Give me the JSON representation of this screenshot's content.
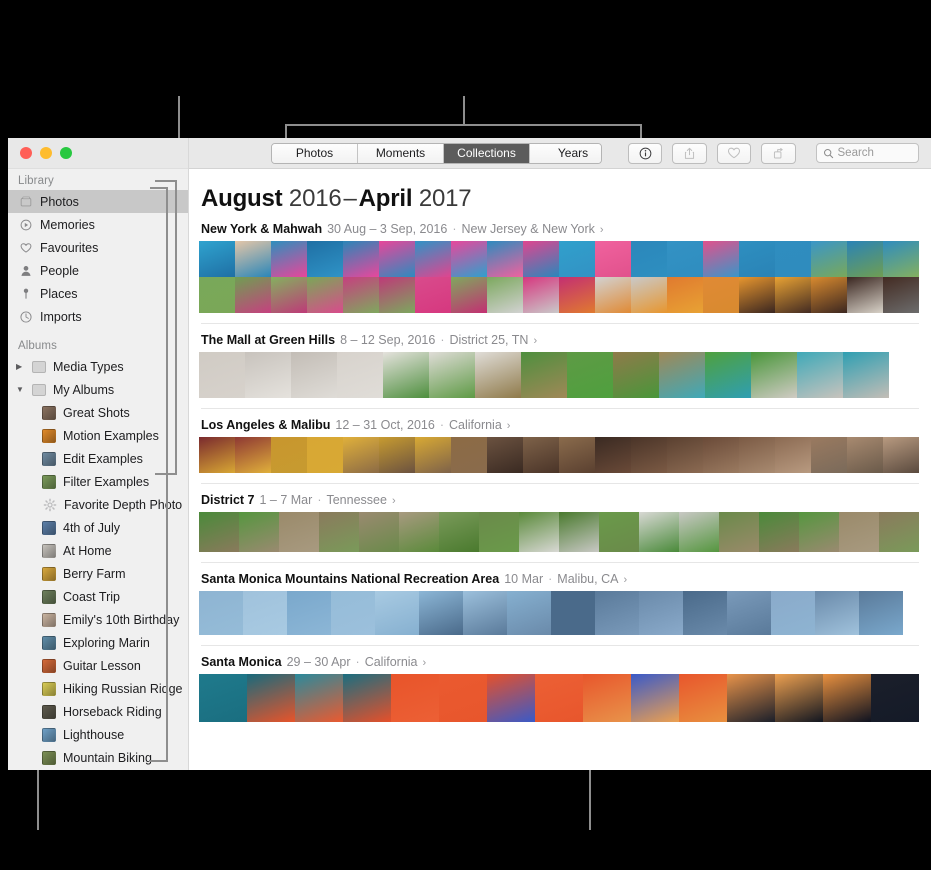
{
  "window": {
    "traffic_lights": [
      "close",
      "minimize",
      "zoom"
    ]
  },
  "sidebar": {
    "sections": [
      {
        "title": "Library",
        "items": [
          {
            "label": "Photos",
            "icon": "photos-icon",
            "selected": true
          },
          {
            "label": "Memories",
            "icon": "memories-icon",
            "selected": false
          },
          {
            "label": "Favourites",
            "icon": "heart-icon",
            "selected": false
          },
          {
            "label": "People",
            "icon": "person-icon",
            "selected": false
          },
          {
            "label": "Places",
            "icon": "pin-icon",
            "selected": false
          },
          {
            "label": "Imports",
            "icon": "clock-icon",
            "selected": false
          }
        ]
      },
      {
        "title": "Albums",
        "items": [
          {
            "label": "Media Types",
            "icon": "folder-icon",
            "disclosure": "collapsed",
            "indent": 0
          },
          {
            "label": "My Albums",
            "icon": "folder-icon",
            "disclosure": "expanded",
            "indent": 0
          },
          {
            "label": "Great Shots",
            "icon": "album-thumb",
            "indent": 1,
            "thumb": "#8a7260"
          },
          {
            "label": "Motion Examples",
            "icon": "album-thumb",
            "indent": 1,
            "thumb": "#e08a2a"
          },
          {
            "label": "Edit Examples",
            "icon": "album-thumb",
            "indent": 1,
            "thumb": "#6f8aa0"
          },
          {
            "label": "Filter Examples",
            "icon": "album-thumb",
            "indent": 1,
            "thumb": "#7a9a5a"
          },
          {
            "label": "Favorite Depth Photo",
            "icon": "gear-icon",
            "indent": 1
          },
          {
            "label": "4th of July",
            "icon": "album-thumb",
            "indent": 1,
            "thumb": "#5c7fa8"
          },
          {
            "label": "At Home",
            "icon": "album-thumb",
            "indent": 1,
            "thumb": "#c6c2bc"
          },
          {
            "label": "Berry Farm",
            "icon": "album-thumb",
            "indent": 1,
            "thumb": "#d8a83e"
          },
          {
            "label": "Coast Trip",
            "icon": "album-thumb",
            "indent": 1,
            "thumb": "#6d7f5c"
          },
          {
            "label": "Emily's 10th Birthday",
            "icon": "album-thumb",
            "indent": 1,
            "thumb": "#c9b3a0"
          },
          {
            "label": "Exploring Marin",
            "icon": "album-thumb",
            "indent": 1,
            "thumb": "#5f8ca8"
          },
          {
            "label": "Guitar Lesson",
            "icon": "album-thumb",
            "indent": 1,
            "thumb": "#d46a3a"
          },
          {
            "label": "Hiking Russian Ridge",
            "icon": "album-thumb",
            "indent": 1,
            "thumb": "#d8cb55"
          },
          {
            "label": "Horseback Riding",
            "icon": "album-thumb",
            "indent": 1,
            "thumb": "#5d5a4d"
          },
          {
            "label": "Lighthouse",
            "icon": "album-thumb",
            "indent": 1,
            "thumb": "#6fa0c6"
          },
          {
            "label": "Mountain Biking",
            "icon": "album-thumb",
            "indent": 1,
            "thumb": "#7b8f54"
          }
        ]
      }
    ]
  },
  "toolbar": {
    "segments": [
      {
        "label": "Photos",
        "active": false
      },
      {
        "label": "Moments",
        "active": false
      },
      {
        "label": "Collections",
        "active": true
      },
      {
        "label": "Years",
        "active": false
      }
    ],
    "buttons": [
      {
        "name": "info-button",
        "icon": "info-icon",
        "enabled": true
      },
      {
        "name": "share-button",
        "icon": "share-icon",
        "enabled": false
      },
      {
        "name": "favorite-button",
        "icon": "heart-icon",
        "enabled": false
      },
      {
        "name": "rotate-button",
        "icon": "rotate-icon",
        "enabled": false
      }
    ],
    "search": {
      "placeholder": "Search",
      "value": "",
      "icon": "search-icon"
    }
  },
  "main": {
    "title": {
      "month_start": "August",
      "year_start": "2016",
      "dash": "–",
      "month_end": "April",
      "year_end": "2017"
    },
    "collections": [
      {
        "name": "New York & Mahwah",
        "date": "30 Aug – 3 Sep, 2016",
        "separator": "·",
        "place": "New Jersey & New York",
        "chevron": "›",
        "rows": 2,
        "tile": 36,
        "tiles": [
          "#2fa3cf",
          "#e4c6a8",
          "#2d8fbd",
          "#1f6fa4",
          "#2a86b8",
          "#e8469a",
          "#2f93c6",
          "#e8479c",
          "#2d8bbe",
          "#e0458f",
          "#30a0cc",
          "#f0629e",
          "#2b87bb",
          "#3392c4",
          "#e1518c",
          "#2e8fc0",
          "#2f8dbf",
          "#3a96c8",
          "#2a83b6",
          "#2f8cbe",
          "#79a85a",
          "#6f9e52",
          "#84b05f",
          "#7aa757",
          "#c6407f",
          "#be3a78",
          "#d94b8c",
          "#7fa85e",
          "#7ca85e",
          "#d6387f",
          "#c32f72",
          "#d2d2d2",
          "#c9c9c9",
          "#e07a2f",
          "#e08a35",
          "#e7962f",
          "#e8a234",
          "#d88a2f",
          "#3a2620",
          "#432b22",
          "#3c2720",
          "#d8d2c8",
          "#6c6c6c",
          "#77777a",
          "#d6b58a",
          "#c8a179",
          "#8d8d90",
          "#8e8e92",
          "#8e8e92",
          "#5a5a5e",
          "#c99a6e",
          "#b88a5f",
          "#d9c23a",
          "#c8b133",
          "#9c6640"
        ]
      },
      {
        "name": "The Mall at Green Hills",
        "date": "8 – 12 Sep, 2016",
        "separator": "·",
        "place": "District 25, TN",
        "chevron": "›",
        "rows": 1,
        "tile": 46,
        "tiles": [
          "#d0cbc4",
          "#c8c3bd",
          "#c3bdb6",
          "#d7d2cc",
          "#e5e2dd",
          "#dfdcd7",
          "#e0ddd8",
          "#4e8f3e",
          "#5e9a45",
          "#8f7a4a",
          "#a08857",
          "#4fa03e",
          "#49963a",
          "#3fa9b8",
          "#2f9fb2"
        ]
      },
      {
        "name": "Los Angeles & Malibu",
        "date": "12 – 31 Oct, 2016",
        "separator": "·",
        "place": "California",
        "chevron": "›",
        "rows": 1,
        "tile": 36,
        "tiles": [
          "#7a2a2e",
          "#8e3833",
          "#c8962e",
          "#d8a734",
          "#e0b03b",
          "#c79b30",
          "#d8a934",
          "#8c6b45",
          "#6b5240",
          "#7e6249",
          "#8a6b4c",
          "#3a2a22",
          "#4a3428",
          "#5a4030",
          "#6a4a38",
          "#7b5a44",
          "#8b6a52",
          "#9a7a60",
          "#a88a70",
          "#b89a80",
          "#7a6a5a",
          "#6a5a4a",
          "#5a4a3e",
          "#8a7a6a",
          "#c8a878",
          "#d8b888",
          "#b89868",
          "#a88858"
        ]
      },
      {
        "name": "District 7",
        "date": "1 – 7 Mar",
        "separator": "·",
        "place": "Tennessee",
        "chevron": "›",
        "rows": 1,
        "tile": 40,
        "tiles": [
          "#4a8a3a",
          "#55963f",
          "#9a8a6a",
          "#8a7a5c",
          "#9a8a70",
          "#a89a80",
          "#7a9a5a",
          "#6a8a4a",
          "#5a8a3a",
          "#4a7a2e",
          "#6a9a4a",
          "#d8d8d4",
          "#c8c8c4",
          "#6a8a4a"
        ]
      },
      {
        "name": "Santa Monica Mountains National Recreation Area",
        "date": "10 Mar",
        "separator": "·",
        "place": "Malibu, CA",
        "chevron": "›",
        "rows": 1,
        "tile": 44,
        "tiles": [
          "#8eb4d2",
          "#a0c2dc",
          "#7aa8cc",
          "#95bcd8",
          "#a8cae2",
          "#8cb6d6",
          "#9cc0dc",
          "#86b0d0",
          "#4a6a8a",
          "#5a7a9a",
          "#6a8aaa",
          "#4a6a8a",
          "#7a9aba",
          "#8aaaca",
          "#6a8aaa",
          "#5a7a9a"
        ]
      },
      {
        "name": "Santa Monica",
        "date": "29 – 30 Apr",
        "separator": "·",
        "place": "California",
        "chevron": "›",
        "rows": 1,
        "tile": 48,
        "tiles": [
          "#1f7a8c",
          "#186a7c",
          "#2a8a9c",
          "#1a6e80",
          "#e8542a",
          "#ea5a30",
          "#e6502a",
          "#ec6035",
          "#e8562c",
          "#3a5ac8",
          "#e8562c",
          "#e8934a",
          "#eda050",
          "#e8903f",
          "#1b1f2a",
          "#121620",
          "#0e1220",
          "#141a28",
          "#c8a070",
          "#9a7a58"
        ]
      }
    ]
  },
  "callouts": {
    "sidebar_bracket": "sidebar-callout",
    "toolbar_bracket": "view-tabs-callout",
    "bottom_left": "albums-callout",
    "bottom_right": "collections-callout"
  }
}
